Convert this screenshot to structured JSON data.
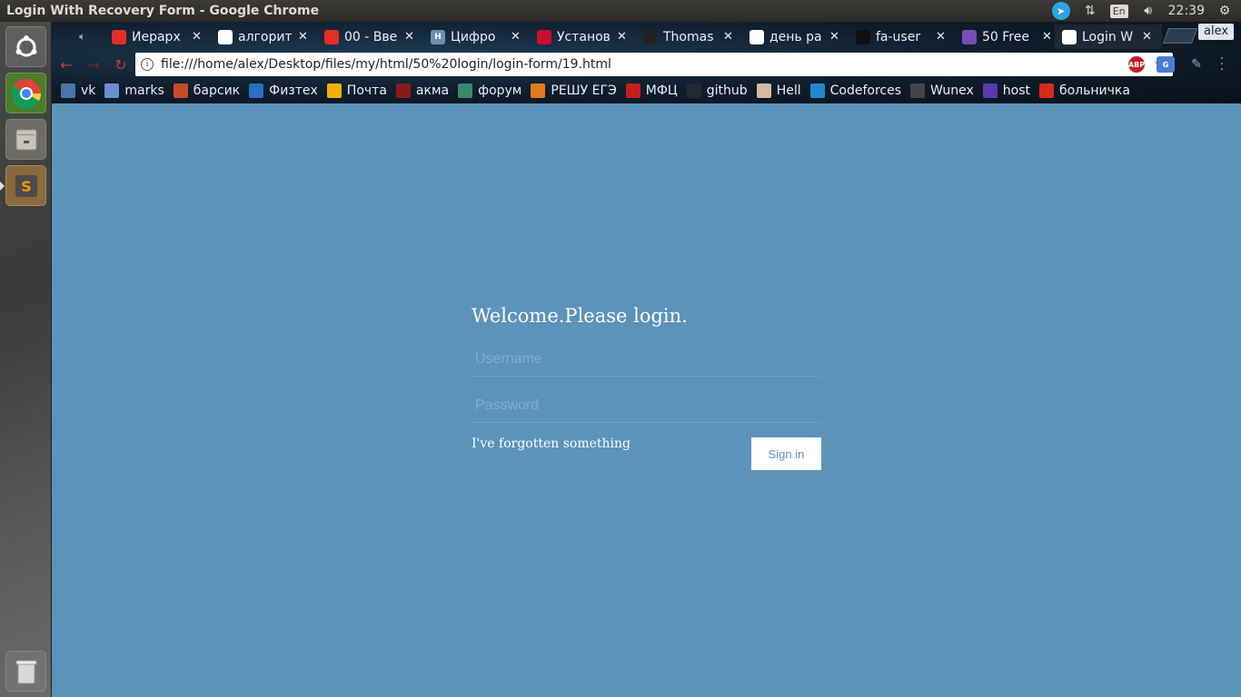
{
  "window": {
    "title": "Login With Recovery Form - Google Chrome"
  },
  "system_tray": {
    "lang": "En",
    "time": "22:39"
  },
  "tabs": [
    {
      "label": "Иерарх",
      "favicon": "youtube",
      "color": "#e52d27"
    },
    {
      "label": "алгорит",
      "favicon": "google",
      "color": "#ffffff"
    },
    {
      "label": "00 - Вве",
      "favicon": "youtube",
      "color": "#e52d27"
    },
    {
      "label": "Цифро",
      "favicon": "H",
      "color": "#6b8fb3"
    },
    {
      "label": "Установ",
      "favicon": "ruby",
      "color": "#c8102e"
    },
    {
      "label": "Thomas",
      "favicon": "avatar",
      "color": "#222222"
    },
    {
      "label": "день ра",
      "favicon": "google",
      "color": "#ffffff"
    },
    {
      "label": "fa-user",
      "favicon": "flag",
      "color": "#111111"
    },
    {
      "label": "50 Free",
      "favicon": "colorlib",
      "color": "#7a4bbb"
    },
    {
      "label": "Login W",
      "favicon": "file",
      "color": "#ffffff"
    }
  ],
  "profile": {
    "name": "alex"
  },
  "address_bar": {
    "url": "file:///home/alex/Desktop/files/my/html/50%20login/login-form/19.html"
  },
  "extensions": {
    "abp": "ABP",
    "translate": "G"
  },
  "bookmarks": [
    {
      "label": "vk",
      "color": "#4a76a8"
    },
    {
      "label": "marks",
      "color": "#6a8fd0"
    },
    {
      "label": "барсик",
      "color": "#c84a2a"
    },
    {
      "label": "Физтех",
      "color": "#2a6fc4"
    },
    {
      "label": "Почта",
      "color": "#f2b100"
    },
    {
      "label": "акма",
      "color": "#8a1a1a"
    },
    {
      "label": "форум",
      "color": "#3a8a6a"
    },
    {
      "label": "РЕШУ ЕГЭ",
      "color": "#e07a1a"
    },
    {
      "label": "МФЦ",
      "color": "#c41f1f"
    },
    {
      "label": "github",
      "color": "#24292e"
    },
    {
      "label": "Hell",
      "color": "#d8b8a0"
    },
    {
      "label": "Codeforces",
      "color": "#1f8ad2"
    },
    {
      "label": "Wunex",
      "color": "#444444"
    },
    {
      "label": "host",
      "color": "#5a3ab0"
    },
    {
      "label": "больничка",
      "color": "#d52b1e"
    }
  ],
  "login": {
    "title": "Welcome.Please login.",
    "username_placeholder": "Username",
    "password_placeholder": "Password",
    "forgot_text": "I've forgotten something",
    "submit_label": "Sign in"
  },
  "colors": {
    "page_bg": "#5b93bb",
    "accent": "#5b93bb"
  }
}
